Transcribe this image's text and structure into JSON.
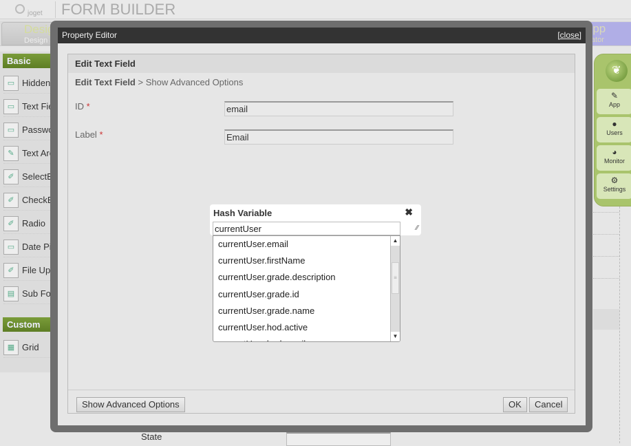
{
  "header": {
    "logo_text": "joget",
    "title": "FORM BUILDER"
  },
  "tabs": [
    {
      "label": "Design",
      "sublabel": "Design a"
    }
  ],
  "app_tab": {
    "label": "e App",
    "sublabel": "ator"
  },
  "palette": {
    "basic_label": "Basic",
    "basic_items": [
      {
        "label": "Hidden F",
        "icon": "field-add-icon"
      },
      {
        "label": "Text Fiel",
        "icon": "field-add-icon"
      },
      {
        "label": "Passwor",
        "icon": "field-add-icon"
      },
      {
        "label": "Text Are",
        "icon": "textarea-icon"
      },
      {
        "label": "SelectBo",
        "icon": "pencil-icon"
      },
      {
        "label": "CheckBo",
        "icon": "pencil-icon"
      },
      {
        "label": "Radio",
        "icon": "pencil-icon"
      },
      {
        "label": "Date Pic",
        "icon": "field-add-icon"
      },
      {
        "label": "File Uplo",
        "icon": "pencil-icon"
      },
      {
        "label": "Sub Forr",
        "icon": "subform-icon"
      }
    ],
    "custom_label": "Custom",
    "custom_items": [
      {
        "label": "Grid",
        "icon": "grid-icon"
      }
    ]
  },
  "background_form": {
    "state_label": "State"
  },
  "right_nav": {
    "items": [
      {
        "label": "App",
        "icon": "edit-icon"
      },
      {
        "label": "Users",
        "icon": "user-icon"
      },
      {
        "label": "Monitor",
        "icon": "gauge-icon"
      },
      {
        "label": "Settings",
        "icon": "gears-icon"
      }
    ]
  },
  "modal": {
    "title": "Property Editor",
    "close_label": "[close]",
    "panel_title": "Edit Text Field",
    "breadcrumb_current": "Edit Text Field",
    "breadcrumb_sep": " > ",
    "breadcrumb_link": "Show Advanced Options",
    "fields": [
      {
        "label": "ID",
        "required": "*",
        "value": "email"
      },
      {
        "label": "Label",
        "required": "*",
        "value": "Email"
      }
    ],
    "advanced_button": "Show Advanced Options",
    "ok_button": "OK",
    "cancel_button": "Cancel"
  },
  "hash_variable": {
    "title": "Hash Variable",
    "close_icon": "✖",
    "input_value": "currentUser",
    "options": [
      "currentUser.email",
      "currentUser.firstName",
      "currentUser.grade.description",
      "currentUser.grade.id",
      "currentUser.grade.name",
      "currentUser.hod.active",
      "currentUser.hod.email"
    ]
  },
  "colors": {
    "palette_header": "#6b8e2f",
    "right_nav": "#a9c46c",
    "modal_titlebar": "#333333",
    "app_tab": "#b0aee6"
  }
}
